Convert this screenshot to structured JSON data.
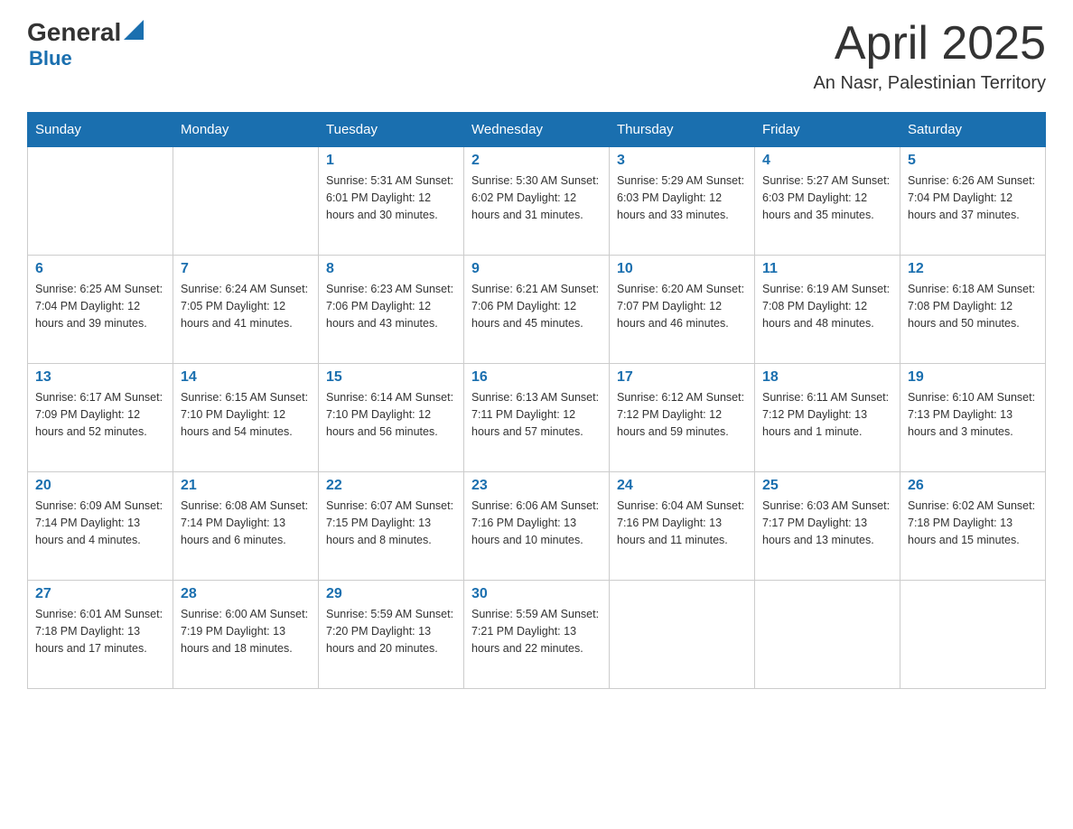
{
  "header": {
    "logo_general": "General",
    "logo_blue": "Blue",
    "title": "April 2025",
    "subtitle": "An Nasr, Palestinian Territory"
  },
  "days_of_week": [
    "Sunday",
    "Monday",
    "Tuesday",
    "Wednesday",
    "Thursday",
    "Friday",
    "Saturday"
  ],
  "weeks": [
    [
      {
        "day": "",
        "info": ""
      },
      {
        "day": "",
        "info": ""
      },
      {
        "day": "1",
        "info": "Sunrise: 5:31 AM\nSunset: 6:01 PM\nDaylight: 12 hours\nand 30 minutes."
      },
      {
        "day": "2",
        "info": "Sunrise: 5:30 AM\nSunset: 6:02 PM\nDaylight: 12 hours\nand 31 minutes."
      },
      {
        "day": "3",
        "info": "Sunrise: 5:29 AM\nSunset: 6:03 PM\nDaylight: 12 hours\nand 33 minutes."
      },
      {
        "day": "4",
        "info": "Sunrise: 5:27 AM\nSunset: 6:03 PM\nDaylight: 12 hours\nand 35 minutes."
      },
      {
        "day": "5",
        "info": "Sunrise: 6:26 AM\nSunset: 7:04 PM\nDaylight: 12 hours\nand 37 minutes."
      }
    ],
    [
      {
        "day": "6",
        "info": "Sunrise: 6:25 AM\nSunset: 7:04 PM\nDaylight: 12 hours\nand 39 minutes."
      },
      {
        "day": "7",
        "info": "Sunrise: 6:24 AM\nSunset: 7:05 PM\nDaylight: 12 hours\nand 41 minutes."
      },
      {
        "day": "8",
        "info": "Sunrise: 6:23 AM\nSunset: 7:06 PM\nDaylight: 12 hours\nand 43 minutes."
      },
      {
        "day": "9",
        "info": "Sunrise: 6:21 AM\nSunset: 7:06 PM\nDaylight: 12 hours\nand 45 minutes."
      },
      {
        "day": "10",
        "info": "Sunrise: 6:20 AM\nSunset: 7:07 PM\nDaylight: 12 hours\nand 46 minutes."
      },
      {
        "day": "11",
        "info": "Sunrise: 6:19 AM\nSunset: 7:08 PM\nDaylight: 12 hours\nand 48 minutes."
      },
      {
        "day": "12",
        "info": "Sunrise: 6:18 AM\nSunset: 7:08 PM\nDaylight: 12 hours\nand 50 minutes."
      }
    ],
    [
      {
        "day": "13",
        "info": "Sunrise: 6:17 AM\nSunset: 7:09 PM\nDaylight: 12 hours\nand 52 minutes."
      },
      {
        "day": "14",
        "info": "Sunrise: 6:15 AM\nSunset: 7:10 PM\nDaylight: 12 hours\nand 54 minutes."
      },
      {
        "day": "15",
        "info": "Sunrise: 6:14 AM\nSunset: 7:10 PM\nDaylight: 12 hours\nand 56 minutes."
      },
      {
        "day": "16",
        "info": "Sunrise: 6:13 AM\nSunset: 7:11 PM\nDaylight: 12 hours\nand 57 minutes."
      },
      {
        "day": "17",
        "info": "Sunrise: 6:12 AM\nSunset: 7:12 PM\nDaylight: 12 hours\nand 59 minutes."
      },
      {
        "day": "18",
        "info": "Sunrise: 6:11 AM\nSunset: 7:12 PM\nDaylight: 13 hours\nand 1 minute."
      },
      {
        "day": "19",
        "info": "Sunrise: 6:10 AM\nSunset: 7:13 PM\nDaylight: 13 hours\nand 3 minutes."
      }
    ],
    [
      {
        "day": "20",
        "info": "Sunrise: 6:09 AM\nSunset: 7:14 PM\nDaylight: 13 hours\nand 4 minutes."
      },
      {
        "day": "21",
        "info": "Sunrise: 6:08 AM\nSunset: 7:14 PM\nDaylight: 13 hours\nand 6 minutes."
      },
      {
        "day": "22",
        "info": "Sunrise: 6:07 AM\nSunset: 7:15 PM\nDaylight: 13 hours\nand 8 minutes."
      },
      {
        "day": "23",
        "info": "Sunrise: 6:06 AM\nSunset: 7:16 PM\nDaylight: 13 hours\nand 10 minutes."
      },
      {
        "day": "24",
        "info": "Sunrise: 6:04 AM\nSunset: 7:16 PM\nDaylight: 13 hours\nand 11 minutes."
      },
      {
        "day": "25",
        "info": "Sunrise: 6:03 AM\nSunset: 7:17 PM\nDaylight: 13 hours\nand 13 minutes."
      },
      {
        "day": "26",
        "info": "Sunrise: 6:02 AM\nSunset: 7:18 PM\nDaylight: 13 hours\nand 15 minutes."
      }
    ],
    [
      {
        "day": "27",
        "info": "Sunrise: 6:01 AM\nSunset: 7:18 PM\nDaylight: 13 hours\nand 17 minutes."
      },
      {
        "day": "28",
        "info": "Sunrise: 6:00 AM\nSunset: 7:19 PM\nDaylight: 13 hours\nand 18 minutes."
      },
      {
        "day": "29",
        "info": "Sunrise: 5:59 AM\nSunset: 7:20 PM\nDaylight: 13 hours\nand 20 minutes."
      },
      {
        "day": "30",
        "info": "Sunrise: 5:59 AM\nSunset: 7:21 PM\nDaylight: 13 hours\nand 22 minutes."
      },
      {
        "day": "",
        "info": ""
      },
      {
        "day": "",
        "info": ""
      },
      {
        "day": "",
        "info": ""
      }
    ]
  ]
}
